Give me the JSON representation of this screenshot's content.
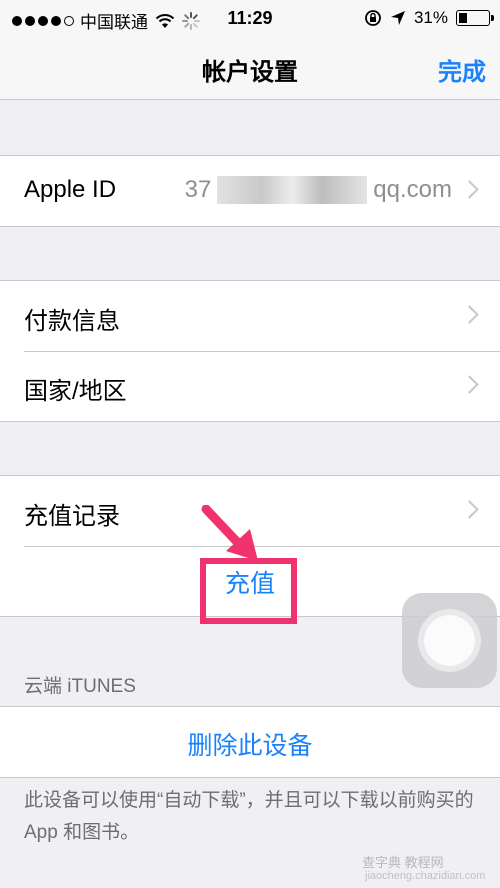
{
  "status": {
    "carrier": "中国联通",
    "time": "11:29",
    "battery": "31%",
    "battery_level": 0.31,
    "icons": [
      "wifi-icon",
      "activity-spinner-icon",
      "rotation-lock-icon",
      "location-arrow-icon",
      "battery-icon"
    ]
  },
  "nav": {
    "title": "帐户设置",
    "done": "完成"
  },
  "account": {
    "label": "Apple ID",
    "value_prefix": "37",
    "value_suffix": "qq.com"
  },
  "payment_items": [
    {
      "label": "付款信息"
    },
    {
      "label": "国家/地区"
    }
  ],
  "topup": {
    "history_label": "充值记录",
    "action_label": "充值"
  },
  "cloud": {
    "header": "云端 iTUNES",
    "remove_label": "删除此设备",
    "footer": "此设备可以使用“自动下载”，并且可以下载以前购买的 App 和图书。"
  },
  "watermark": {
    "text": "查字典 教程网",
    "sub": "jiaocheng.chazidian.com"
  },
  "colors": {
    "accent": "#1a82fb",
    "highlight": "#f0336e",
    "background": "#efeff4"
  }
}
